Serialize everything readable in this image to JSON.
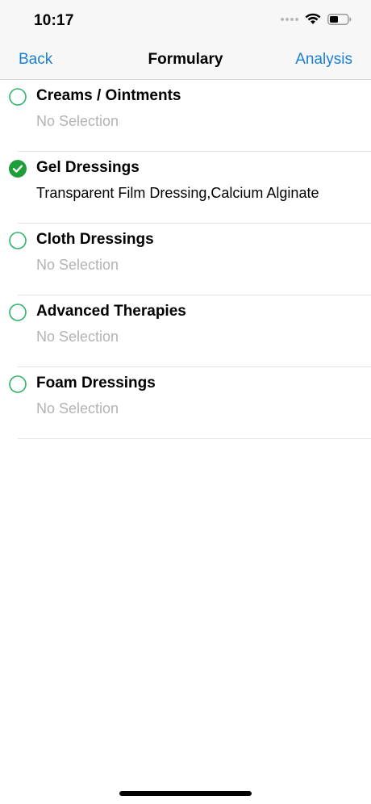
{
  "status_bar": {
    "time": "10:17"
  },
  "navbar": {
    "back_label": "Back",
    "title": "Formulary",
    "right_label": "Analysis"
  },
  "items": [
    {
      "title": "Creams / Ointments",
      "subtitle": "No Selection",
      "checked": false
    },
    {
      "title": "Gel Dressings",
      "subtitle": "Transparent Film Dressing,Calcium Alginate",
      "checked": true
    },
    {
      "title": "Cloth Dressings",
      "subtitle": "No Selection",
      "checked": false
    },
    {
      "title": "Advanced Therapies",
      "subtitle": "No Selection",
      "checked": false
    },
    {
      "title": "Foam Dressings",
      "subtitle": "No Selection",
      "checked": false
    }
  ],
  "colors": {
    "accent": "#1a7fd4",
    "check_green": "#1e9e3a",
    "ring_green": "#2db469"
  }
}
